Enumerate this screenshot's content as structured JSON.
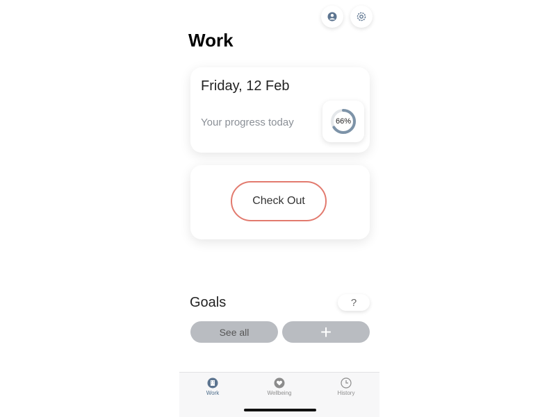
{
  "header": {
    "title": "Work"
  },
  "today_card": {
    "date": "Friday, 12 Feb",
    "progress_label": "Your progress today",
    "progress_text": "66%",
    "progress_fraction": 0.66
  },
  "checkout": {
    "label": "Check Out"
  },
  "goals": {
    "title": "Goals",
    "help_label": "?",
    "see_all_label": "See all",
    "add_label": "+"
  },
  "tabbar": {
    "tabs": [
      {
        "label": "Work",
        "icon": "building-icon",
        "active": true
      },
      {
        "label": "Wellbeing",
        "icon": "heart-icon",
        "active": false
      },
      {
        "label": "History",
        "icon": "clock-icon",
        "active": false
      }
    ]
  },
  "colors": {
    "accent": "#4c6c8a",
    "checkout_border": "#e27a6e",
    "pill": "#b9bcc1"
  }
}
